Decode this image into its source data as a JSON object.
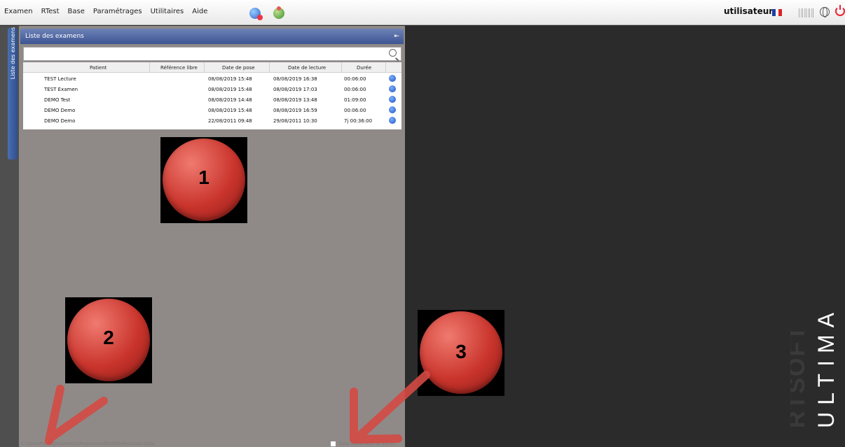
{
  "menubar": {
    "items": [
      "Examen",
      "RTest",
      "Base",
      "Paramétrages",
      "Utilitaires",
      "Aide"
    ],
    "icons": [
      "rtest-wizard-icon",
      "help-icon"
    ],
    "user": "utilisateur.c",
    "right_icons": [
      "french-flag-icon",
      "barcode-icon",
      "globe-icon",
      "power-icon"
    ]
  },
  "sidebar": {
    "tab_label": "Liste des examens"
  },
  "panel": {
    "title": "Liste des examens",
    "pin_glyph": "⇤",
    "search": {
      "value": "",
      "placeholder": ""
    },
    "columns": [
      "Patient",
      "Référence libre",
      "Date de pose",
      "Date de lecture",
      "Durée"
    ],
    "rows": [
      [
        "TEST Lecture",
        "",
        "08/08/2019 15:48",
        "08/08/2019 16:38",
        "00:06:00"
      ],
      [
        "TEST Examen",
        "",
        "08/08/2019 15:48",
        "08/08/2019 17:03",
        "00:06:00"
      ],
      [
        "DEMO Test",
        "",
        "08/08/2019 14:48",
        "08/08/2019 13:48",
        "01:09:00"
      ],
      [
        "DEMO Demo",
        "",
        "08/08/2019 15:48",
        "08/08/2019 16:59",
        "00:06:00"
      ],
      [
        "DEMO Demo",
        "",
        "22/08/2011 09:48",
        "29/08/2011 10:30",
        "7j 00:36:00"
      ]
    ],
    "row_action_icon": "edit-icon"
  },
  "footer": {
    "path": "C:\\Users\\Public\\Documents\\Ressources\\RtestDb\\Resultats.sqlite",
    "checkbox_label": "Base d'examens de travail",
    "checkbox_checked": false
  },
  "logo": {
    "text_top": "RTSOFT",
    "text_bottom": "ULTIMA"
  },
  "annotations": [
    "1",
    "2",
    "3"
  ],
  "colors": {
    "header_blue": "#3d5594",
    "panel_gray": "#8f8a88",
    "background": "#2b2b2b",
    "annotation_red": "#c9342c",
    "arrow_red": "#d44a44"
  }
}
